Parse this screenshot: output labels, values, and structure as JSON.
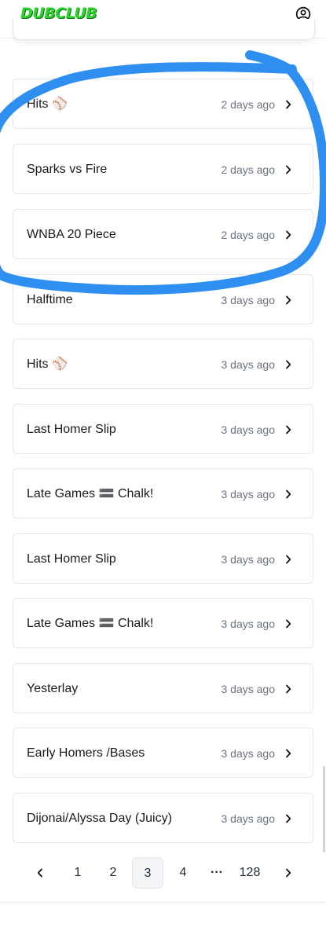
{
  "header": {
    "logo_text": "DUBCLUB",
    "account_icon": "user-circle-icon"
  },
  "picks": [
    {
      "title": "Hits ⚾️",
      "time": "2 days ago"
    },
    {
      "title": "Sparks vs Fire",
      "time": "2 days ago"
    },
    {
      "title": "WNBA 20 Piece",
      "time": "2 days ago"
    },
    {
      "title": "Halftime",
      "time": "3 days ago"
    },
    {
      "title": "Hits ⚾️",
      "time": "3 days ago"
    },
    {
      "title": "Last Homer Slip",
      "time": "3 days ago"
    },
    {
      "title": "Late Games 🟰 Chalk!",
      "time": "3 days ago"
    },
    {
      "title": "Last Homer Slip",
      "time": "3 days ago"
    },
    {
      "title": "Late Games 🟰 Chalk!",
      "time": "3 days ago"
    },
    {
      "title": "Yesterlay",
      "time": "3 days ago"
    },
    {
      "title": "Early Homers /Bases",
      "time": "3 days ago"
    },
    {
      "title": "Dijonai/Alyssa Day (Juicy)",
      "time": "3 days ago"
    }
  ],
  "pagination": {
    "prev_icon": "chevron-left-icon",
    "pages": [
      "1",
      "2",
      "3",
      "4"
    ],
    "current": "3",
    "ellipsis": "···",
    "last": "128",
    "next_icon": "chevron-right-icon"
  },
  "colors": {
    "brand": "#2ed32e",
    "annotation": "#2f8ff0",
    "border": "#e5e7eb",
    "muted_text": "#6b7280"
  }
}
